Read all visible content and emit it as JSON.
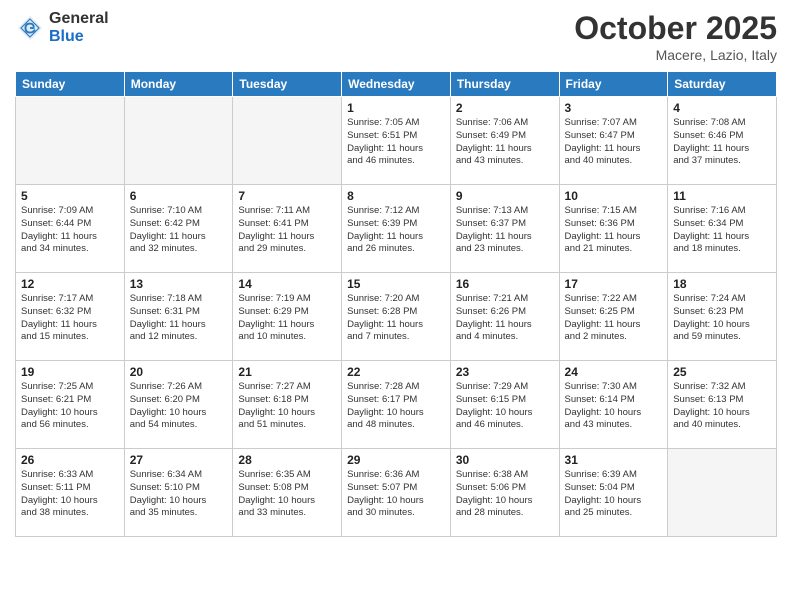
{
  "header": {
    "logo_general": "General",
    "logo_blue": "Blue",
    "month": "October 2025",
    "location": "Macere, Lazio, Italy"
  },
  "weekdays": [
    "Sunday",
    "Monday",
    "Tuesday",
    "Wednesday",
    "Thursday",
    "Friday",
    "Saturday"
  ],
  "weeks": [
    [
      {
        "day": "",
        "info": ""
      },
      {
        "day": "",
        "info": ""
      },
      {
        "day": "",
        "info": ""
      },
      {
        "day": "1",
        "info": "Sunrise: 7:05 AM\nSunset: 6:51 PM\nDaylight: 11 hours\nand 46 minutes."
      },
      {
        "day": "2",
        "info": "Sunrise: 7:06 AM\nSunset: 6:49 PM\nDaylight: 11 hours\nand 43 minutes."
      },
      {
        "day": "3",
        "info": "Sunrise: 7:07 AM\nSunset: 6:47 PM\nDaylight: 11 hours\nand 40 minutes."
      },
      {
        "day": "4",
        "info": "Sunrise: 7:08 AM\nSunset: 6:46 PM\nDaylight: 11 hours\nand 37 minutes."
      }
    ],
    [
      {
        "day": "5",
        "info": "Sunrise: 7:09 AM\nSunset: 6:44 PM\nDaylight: 11 hours\nand 34 minutes."
      },
      {
        "day": "6",
        "info": "Sunrise: 7:10 AM\nSunset: 6:42 PM\nDaylight: 11 hours\nand 32 minutes."
      },
      {
        "day": "7",
        "info": "Sunrise: 7:11 AM\nSunset: 6:41 PM\nDaylight: 11 hours\nand 29 minutes."
      },
      {
        "day": "8",
        "info": "Sunrise: 7:12 AM\nSunset: 6:39 PM\nDaylight: 11 hours\nand 26 minutes."
      },
      {
        "day": "9",
        "info": "Sunrise: 7:13 AM\nSunset: 6:37 PM\nDaylight: 11 hours\nand 23 minutes."
      },
      {
        "day": "10",
        "info": "Sunrise: 7:15 AM\nSunset: 6:36 PM\nDaylight: 11 hours\nand 21 minutes."
      },
      {
        "day": "11",
        "info": "Sunrise: 7:16 AM\nSunset: 6:34 PM\nDaylight: 11 hours\nand 18 minutes."
      }
    ],
    [
      {
        "day": "12",
        "info": "Sunrise: 7:17 AM\nSunset: 6:32 PM\nDaylight: 11 hours\nand 15 minutes."
      },
      {
        "day": "13",
        "info": "Sunrise: 7:18 AM\nSunset: 6:31 PM\nDaylight: 11 hours\nand 12 minutes."
      },
      {
        "day": "14",
        "info": "Sunrise: 7:19 AM\nSunset: 6:29 PM\nDaylight: 11 hours\nand 10 minutes."
      },
      {
        "day": "15",
        "info": "Sunrise: 7:20 AM\nSunset: 6:28 PM\nDaylight: 11 hours\nand 7 minutes."
      },
      {
        "day": "16",
        "info": "Sunrise: 7:21 AM\nSunset: 6:26 PM\nDaylight: 11 hours\nand 4 minutes."
      },
      {
        "day": "17",
        "info": "Sunrise: 7:22 AM\nSunset: 6:25 PM\nDaylight: 11 hours\nand 2 minutes."
      },
      {
        "day": "18",
        "info": "Sunrise: 7:24 AM\nSunset: 6:23 PM\nDaylight: 10 hours\nand 59 minutes."
      }
    ],
    [
      {
        "day": "19",
        "info": "Sunrise: 7:25 AM\nSunset: 6:21 PM\nDaylight: 10 hours\nand 56 minutes."
      },
      {
        "day": "20",
        "info": "Sunrise: 7:26 AM\nSunset: 6:20 PM\nDaylight: 10 hours\nand 54 minutes."
      },
      {
        "day": "21",
        "info": "Sunrise: 7:27 AM\nSunset: 6:18 PM\nDaylight: 10 hours\nand 51 minutes."
      },
      {
        "day": "22",
        "info": "Sunrise: 7:28 AM\nSunset: 6:17 PM\nDaylight: 10 hours\nand 48 minutes."
      },
      {
        "day": "23",
        "info": "Sunrise: 7:29 AM\nSunset: 6:15 PM\nDaylight: 10 hours\nand 46 minutes."
      },
      {
        "day": "24",
        "info": "Sunrise: 7:30 AM\nSunset: 6:14 PM\nDaylight: 10 hours\nand 43 minutes."
      },
      {
        "day": "25",
        "info": "Sunrise: 7:32 AM\nSunset: 6:13 PM\nDaylight: 10 hours\nand 40 minutes."
      }
    ],
    [
      {
        "day": "26",
        "info": "Sunrise: 6:33 AM\nSunset: 5:11 PM\nDaylight: 10 hours\nand 38 minutes."
      },
      {
        "day": "27",
        "info": "Sunrise: 6:34 AM\nSunset: 5:10 PM\nDaylight: 10 hours\nand 35 minutes."
      },
      {
        "day": "28",
        "info": "Sunrise: 6:35 AM\nSunset: 5:08 PM\nDaylight: 10 hours\nand 33 minutes."
      },
      {
        "day": "29",
        "info": "Sunrise: 6:36 AM\nSunset: 5:07 PM\nDaylight: 10 hours\nand 30 minutes."
      },
      {
        "day": "30",
        "info": "Sunrise: 6:38 AM\nSunset: 5:06 PM\nDaylight: 10 hours\nand 28 minutes."
      },
      {
        "day": "31",
        "info": "Sunrise: 6:39 AM\nSunset: 5:04 PM\nDaylight: 10 hours\nand 25 minutes."
      },
      {
        "day": "",
        "info": ""
      }
    ]
  ]
}
